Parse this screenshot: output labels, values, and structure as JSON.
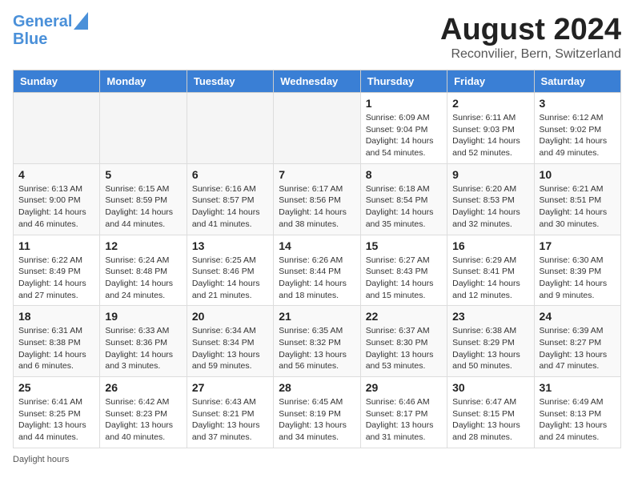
{
  "header": {
    "logo_line1": "General",
    "logo_line2": "Blue",
    "title": "August 2024",
    "subtitle": "Reconvilier, Bern, Switzerland"
  },
  "days_of_week": [
    "Sunday",
    "Monday",
    "Tuesday",
    "Wednesday",
    "Thursday",
    "Friday",
    "Saturday"
  ],
  "weeks": [
    [
      {
        "day": "",
        "empty": true
      },
      {
        "day": "",
        "empty": true
      },
      {
        "day": "",
        "empty": true
      },
      {
        "day": "",
        "empty": true
      },
      {
        "day": "1",
        "sunrise": "6:09 AM",
        "sunset": "9:04 PM",
        "daylight": "14 hours and 54 minutes."
      },
      {
        "day": "2",
        "sunrise": "6:11 AM",
        "sunset": "9:03 PM",
        "daylight": "14 hours and 52 minutes."
      },
      {
        "day": "3",
        "sunrise": "6:12 AM",
        "sunset": "9:02 PM",
        "daylight": "14 hours and 49 minutes."
      }
    ],
    [
      {
        "day": "4",
        "sunrise": "6:13 AM",
        "sunset": "9:00 PM",
        "daylight": "14 hours and 46 minutes."
      },
      {
        "day": "5",
        "sunrise": "6:15 AM",
        "sunset": "8:59 PM",
        "daylight": "14 hours and 44 minutes."
      },
      {
        "day": "6",
        "sunrise": "6:16 AM",
        "sunset": "8:57 PM",
        "daylight": "14 hours and 41 minutes."
      },
      {
        "day": "7",
        "sunrise": "6:17 AM",
        "sunset": "8:56 PM",
        "daylight": "14 hours and 38 minutes."
      },
      {
        "day": "8",
        "sunrise": "6:18 AM",
        "sunset": "8:54 PM",
        "daylight": "14 hours and 35 minutes."
      },
      {
        "day": "9",
        "sunrise": "6:20 AM",
        "sunset": "8:53 PM",
        "daylight": "14 hours and 32 minutes."
      },
      {
        "day": "10",
        "sunrise": "6:21 AM",
        "sunset": "8:51 PM",
        "daylight": "14 hours and 30 minutes."
      }
    ],
    [
      {
        "day": "11",
        "sunrise": "6:22 AM",
        "sunset": "8:49 PM",
        "daylight": "14 hours and 27 minutes."
      },
      {
        "day": "12",
        "sunrise": "6:24 AM",
        "sunset": "8:48 PM",
        "daylight": "14 hours and 24 minutes."
      },
      {
        "day": "13",
        "sunrise": "6:25 AM",
        "sunset": "8:46 PM",
        "daylight": "14 hours and 21 minutes."
      },
      {
        "day": "14",
        "sunrise": "6:26 AM",
        "sunset": "8:44 PM",
        "daylight": "14 hours and 18 minutes."
      },
      {
        "day": "15",
        "sunrise": "6:27 AM",
        "sunset": "8:43 PM",
        "daylight": "14 hours and 15 minutes."
      },
      {
        "day": "16",
        "sunrise": "6:29 AM",
        "sunset": "8:41 PM",
        "daylight": "14 hours and 12 minutes."
      },
      {
        "day": "17",
        "sunrise": "6:30 AM",
        "sunset": "8:39 PM",
        "daylight": "14 hours and 9 minutes."
      }
    ],
    [
      {
        "day": "18",
        "sunrise": "6:31 AM",
        "sunset": "8:38 PM",
        "daylight": "14 hours and 6 minutes."
      },
      {
        "day": "19",
        "sunrise": "6:33 AM",
        "sunset": "8:36 PM",
        "daylight": "14 hours and 3 minutes."
      },
      {
        "day": "20",
        "sunrise": "6:34 AM",
        "sunset": "8:34 PM",
        "daylight": "13 hours and 59 minutes."
      },
      {
        "day": "21",
        "sunrise": "6:35 AM",
        "sunset": "8:32 PM",
        "daylight": "13 hours and 56 minutes."
      },
      {
        "day": "22",
        "sunrise": "6:37 AM",
        "sunset": "8:30 PM",
        "daylight": "13 hours and 53 minutes."
      },
      {
        "day": "23",
        "sunrise": "6:38 AM",
        "sunset": "8:29 PM",
        "daylight": "13 hours and 50 minutes."
      },
      {
        "day": "24",
        "sunrise": "6:39 AM",
        "sunset": "8:27 PM",
        "daylight": "13 hours and 47 minutes."
      }
    ],
    [
      {
        "day": "25",
        "sunrise": "6:41 AM",
        "sunset": "8:25 PM",
        "daylight": "13 hours and 44 minutes."
      },
      {
        "day": "26",
        "sunrise": "6:42 AM",
        "sunset": "8:23 PM",
        "daylight": "13 hours and 40 minutes."
      },
      {
        "day": "27",
        "sunrise": "6:43 AM",
        "sunset": "8:21 PM",
        "daylight": "13 hours and 37 minutes."
      },
      {
        "day": "28",
        "sunrise": "6:45 AM",
        "sunset": "8:19 PM",
        "daylight": "13 hours and 34 minutes."
      },
      {
        "day": "29",
        "sunrise": "6:46 AM",
        "sunset": "8:17 PM",
        "daylight": "13 hours and 31 minutes."
      },
      {
        "day": "30",
        "sunrise": "6:47 AM",
        "sunset": "8:15 PM",
        "daylight": "13 hours and 28 minutes."
      },
      {
        "day": "31",
        "sunrise": "6:49 AM",
        "sunset": "8:13 PM",
        "daylight": "13 hours and 24 minutes."
      }
    ]
  ],
  "footer": {
    "label": "Daylight hours"
  }
}
